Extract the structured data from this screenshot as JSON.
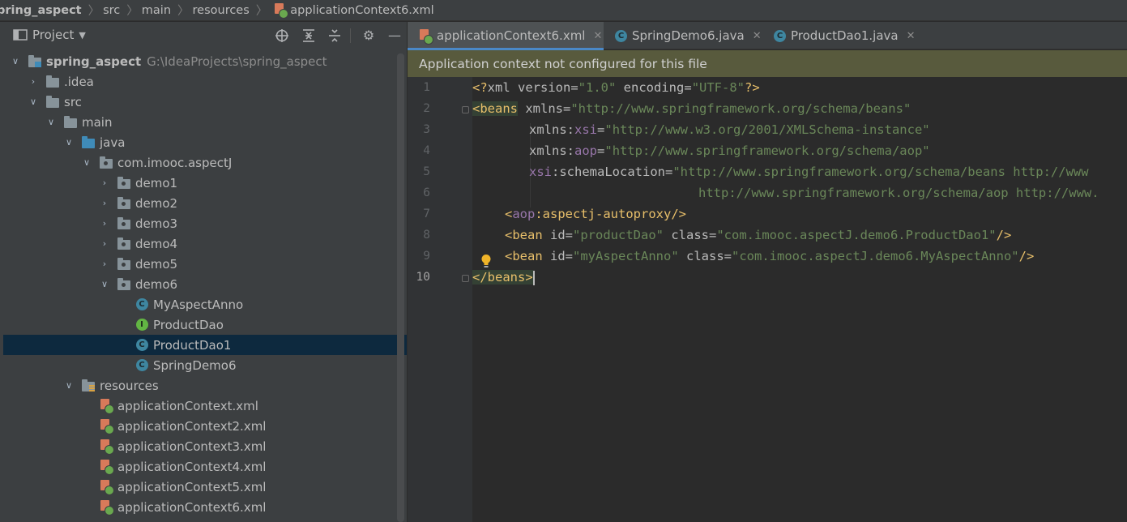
{
  "breadcrumb": {
    "items": [
      "pring_aspect",
      "src",
      "main",
      "resources",
      "applicationContext6.xml"
    ]
  },
  "project_panel": {
    "title": "Project",
    "tree": [
      {
        "label": "spring_aspect",
        "path": "G:\\IdeaProjects\\spring_aspect",
        "depth": 0,
        "state": "open",
        "icon": "module-folder-icon"
      },
      {
        "label": ".idea",
        "depth": 1,
        "state": "closed",
        "icon": "folder-icon"
      },
      {
        "label": "src",
        "depth": 1,
        "state": "open",
        "icon": "folder-icon"
      },
      {
        "label": "main",
        "depth": 2,
        "state": "open",
        "icon": "folder-icon"
      },
      {
        "label": "java",
        "depth": 3,
        "state": "open",
        "icon": "source-folder-icon"
      },
      {
        "label": "com.imooc.aspectJ",
        "depth": 4,
        "state": "open",
        "icon": "package-icon"
      },
      {
        "label": "demo1",
        "depth": 5,
        "state": "closed",
        "icon": "package-icon"
      },
      {
        "label": "demo2",
        "depth": 5,
        "state": "closed",
        "icon": "package-icon"
      },
      {
        "label": "demo3",
        "depth": 5,
        "state": "closed",
        "icon": "package-icon"
      },
      {
        "label": "demo4",
        "depth": 5,
        "state": "closed",
        "icon": "package-icon"
      },
      {
        "label": "demo5",
        "depth": 5,
        "state": "closed",
        "icon": "package-icon"
      },
      {
        "label": "demo6",
        "depth": 5,
        "state": "open",
        "icon": "package-icon"
      },
      {
        "label": "MyAspectAnno",
        "depth": 6,
        "state": "leaf",
        "icon": "class-icon"
      },
      {
        "label": "ProductDao",
        "depth": 6,
        "state": "leaf",
        "icon": "interface-icon"
      },
      {
        "label": "ProductDao1",
        "depth": 6,
        "state": "leaf",
        "icon": "class-icon",
        "selected": true
      },
      {
        "label": "SpringDemo6",
        "depth": 6,
        "state": "leaf",
        "icon": "class-icon"
      },
      {
        "label": "resources",
        "depth": 3,
        "state": "open",
        "icon": "resources-folder-icon"
      },
      {
        "label": "applicationContext.xml",
        "depth": 4,
        "state": "leaf",
        "icon": "spring-xml-icon"
      },
      {
        "label": "applicationContext2.xml",
        "depth": 4,
        "state": "leaf",
        "icon": "spring-xml-icon"
      },
      {
        "label": "applicationContext3.xml",
        "depth": 4,
        "state": "leaf",
        "icon": "spring-xml-icon"
      },
      {
        "label": "applicationContext4.xml",
        "depth": 4,
        "state": "leaf",
        "icon": "spring-xml-icon"
      },
      {
        "label": "applicationContext5.xml",
        "depth": 4,
        "state": "leaf",
        "icon": "spring-xml-icon"
      },
      {
        "label": "applicationContext6.xml",
        "depth": 4,
        "state": "leaf",
        "icon": "spring-xml-icon"
      }
    ]
  },
  "editor": {
    "tabs": [
      {
        "label": "applicationContext6.xml",
        "icon": "spring-xml-icon",
        "active": true
      },
      {
        "label": "SpringDemo6.java",
        "icon": "class-icon",
        "active": false
      },
      {
        "label": "ProductDao1.java",
        "icon": "class-icon",
        "active": false
      }
    ],
    "notice": "Application context not configured for this file",
    "line_numbers": [
      "1",
      "2",
      "3",
      "4",
      "5",
      "6",
      "7",
      "8",
      "9",
      "10"
    ],
    "code": {
      "l1": {
        "a": "<?",
        "b": "xml ",
        "c": "version",
        "d": "=",
        "e": "\"1.0\"",
        "f": " encoding",
        "g": "=",
        "h": "\"UTF-8\"",
        "i": "?>"
      },
      "l2": {
        "a": "<beans",
        "b": " xmlns",
        "c": "=",
        "d": "\"http://www.springframework.org/schema/beans\""
      },
      "l3": {
        "a": "xmlns",
        "b": ":",
        "c": "xsi",
        "d": "=",
        "e": "\"http://www.w3.org/2001/XMLSchema-instance\""
      },
      "l4": {
        "a": "xmlns",
        "b": ":",
        "c": "aop",
        "d": "=",
        "e": "\"http://www.springframework.org/schema/aop\""
      },
      "l5": {
        "a": "xsi",
        "b": ":schemaLocation",
        "c": "=",
        "d": "\"http://www.springframework.org/schema/beans http://www"
      },
      "l6": {
        "a": "http://www.springframework.org/schema/aop http://www."
      },
      "l7": {
        "a": "<",
        "b": "aop",
        "c": ":aspectj-autoproxy",
        "d": "/>"
      },
      "l8": {
        "a": "<bean",
        "b": " id",
        "c": "=",
        "d": "\"productDao\"",
        "e": " class",
        "f": "=",
        "g": "\"com.imooc.aspectJ.demo6.ProductDao1\"",
        "h": "/>"
      },
      "l9": {
        "a": "<bean",
        "b": " id",
        "c": "=",
        "d": "\"myAspectAnno\"",
        "e": " class",
        "f": "=",
        "g": "\"com.imooc.aspectJ.demo6.MyAspectAnno\"",
        "h": "/>"
      },
      "l10": {
        "a": "</beans>"
      }
    }
  },
  "colors": {
    "tag": "#e8bf6a",
    "attribute": "#bababa",
    "namespace": "#9876aa",
    "string": "#6a8759",
    "selection": "#0d293e",
    "notice_bg": "#585a3d",
    "accent": "#4a88c7"
  }
}
